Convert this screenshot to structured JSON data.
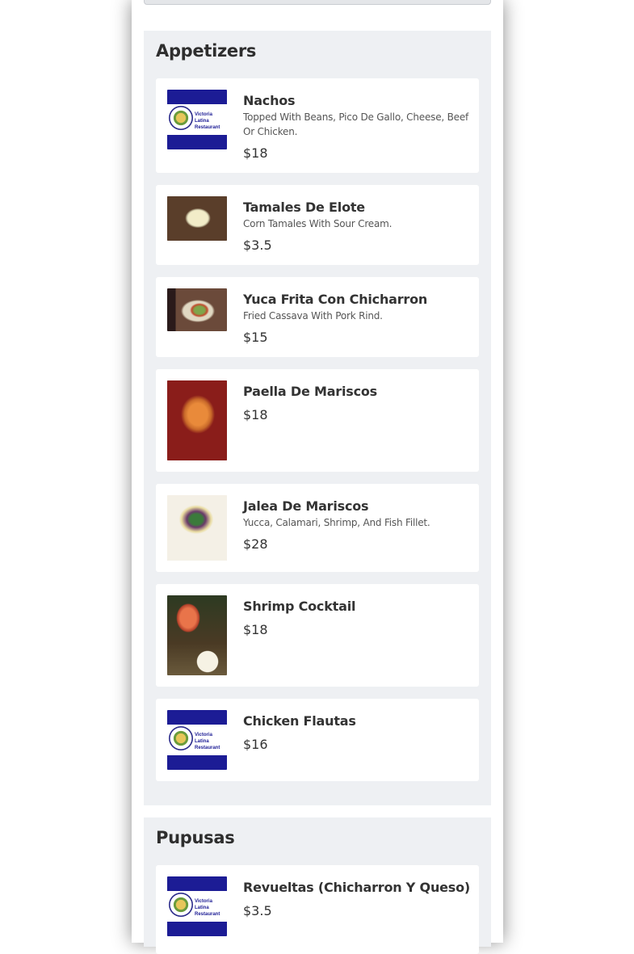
{
  "sections": [
    {
      "title": "Appetizers",
      "items": [
        {
          "name": "Nachos",
          "description": "Topped With Beans, Pico De Gallo, Cheese, Beef Or Chicken.",
          "price": "$18",
          "image": "logo"
        },
        {
          "name": "Tamales De Elote",
          "description": "Corn Tamales With Sour Cream.",
          "price": "$3.5",
          "image": "tamales-photo"
        },
        {
          "name": "Yuca Frita Con Chicharron",
          "description": "Fried Cassava With Pork Rind.",
          "price": "$15",
          "image": "yuca-photo"
        },
        {
          "name": "Paella De Mariscos",
          "description": "",
          "price": "$18",
          "image": "paella-photo"
        },
        {
          "name": "Jalea De Mariscos",
          "description": "Yucca, Calamari, Shrimp, And Fish Fillet.",
          "price": "$28",
          "image": "jalea-photo"
        },
        {
          "name": "Shrimp Cocktail",
          "description": "",
          "price": "$18",
          "image": "shrimp-photo"
        },
        {
          "name": "Chicken Flautas",
          "description": "",
          "price": "$16",
          "image": "logo"
        }
      ]
    },
    {
      "title": "Pupusas",
      "items": [
        {
          "name": "Revueltas (Chicharron Y Queso)",
          "description": "",
          "price": "$3.5",
          "image": "logo"
        }
      ]
    }
  ],
  "logo": {
    "text_line1": "Victoria Latina",
    "text_line2": "Restaurant"
  },
  "colors": {
    "flag_blue": "#1c1c95",
    "section_bg": "#eef0f3",
    "card_bg": "#ffffff",
    "text": "#333333"
  }
}
